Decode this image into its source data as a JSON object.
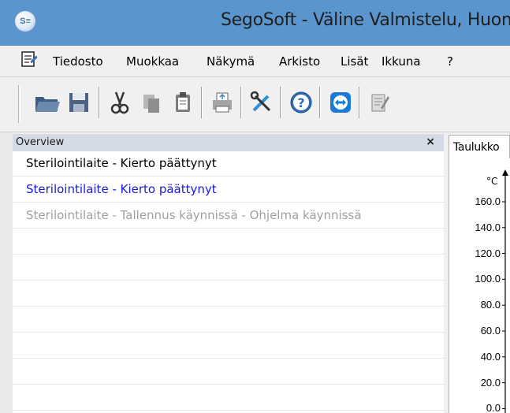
{
  "window": {
    "title": "SegoSoft - Väline Valmistelu, Huom",
    "icon": "segosoft-logo-icon",
    "accent_color": "#5a95ce"
  },
  "menu": {
    "items": [
      "Tiedosto",
      "Muokkaa",
      "Näkymä",
      "Arkisto",
      "Lisät",
      "Ikkuna",
      "?"
    ]
  },
  "toolbar": {
    "buttons": [
      {
        "icon": "open-folder-icon"
      },
      {
        "icon": "save-icon"
      },
      {
        "icon": "cut-icon"
      },
      {
        "icon": "copy-icon"
      },
      {
        "icon": "paste-icon"
      },
      {
        "icon": "print-icon"
      },
      {
        "icon": "tools-icon"
      },
      {
        "icon": "help-icon"
      },
      {
        "icon": "remote-support-icon"
      },
      {
        "icon": "edit-document-icon"
      }
    ]
  },
  "overview": {
    "title": "Overview",
    "close_label": "×",
    "rows": [
      {
        "text": "Sterilointilaite  - Kierto päättynyt",
        "color": "#000000"
      },
      {
        "text": "Sterilointilaite  - Kierto päättynyt",
        "color": "#1a1adc"
      },
      {
        "text": "Sterilointilaite  - Tallennus käynnissä - Ohjelma käynnissä",
        "color": "#a0a0a0"
      },
      {
        "text": "",
        "color": "#000000"
      },
      {
        "text": "",
        "color": "#000000"
      },
      {
        "text": "",
        "color": "#000000"
      },
      {
        "text": "",
        "color": "#000000"
      },
      {
        "text": "",
        "color": "#000000"
      },
      {
        "text": "",
        "color": "#000000"
      },
      {
        "text": "",
        "color": "#000000"
      }
    ]
  },
  "chart_panel": {
    "tab_label": "Taulukko",
    "unit": "°C",
    "y_ticks": [
      "160.0",
      "140.0",
      "120.0",
      "100.0",
      "80.0",
      "60.0",
      "40.0",
      "20.0",
      "0.0"
    ]
  }
}
